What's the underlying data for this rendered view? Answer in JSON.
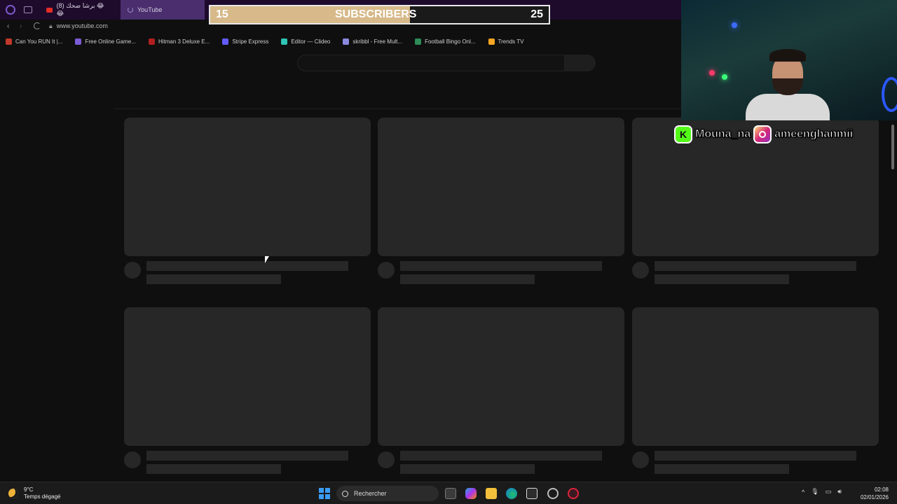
{
  "browser": {
    "tabs": [
      {
        "label": "(8) برشا ضحك 😂😂",
        "active": false
      },
      {
        "label": "YouTube",
        "active": true
      }
    ],
    "url": "www.youtube.com",
    "bookmarks": [
      {
        "label": "Can You RUN It |...",
        "icon_color": "#c0392b"
      },
      {
        "label": "Free Online Game...",
        "icon_color": "#7b5cd6"
      },
      {
        "label": "Hitman 3 Deluxe E...",
        "icon_color": "#b02020"
      },
      {
        "label": "Stripe Express",
        "icon_color": "#635bff"
      },
      {
        "label": "Editor — Clideo",
        "icon_color": "#2ec4b6"
      },
      {
        "label": "skribbl - Free Mult...",
        "icon_color": "#8a8ae0"
      },
      {
        "label": "Football Bingo Onl...",
        "icon_color": "#2e8b57"
      },
      {
        "label": "Trends TV",
        "icon_color": "#f5a623"
      }
    ]
  },
  "overlay": {
    "subscribers": {
      "current": "15",
      "label": "SUBSCRIBERS",
      "goal": "25",
      "progress": 0.59
    },
    "socials": {
      "kick": "Mouna_na",
      "instagram": "ameenghanmii"
    }
  },
  "taskbar": {
    "weather_temp": "9°C",
    "weather_desc": "Temps dégagé",
    "search_placeholder": "Rechercher",
    "time": "02:08",
    "date": "02/01/2026"
  },
  "colors": {
    "accent": "#4a2e6e",
    "skeleton": "#272727",
    "goal_fill": "#d7b98a"
  }
}
